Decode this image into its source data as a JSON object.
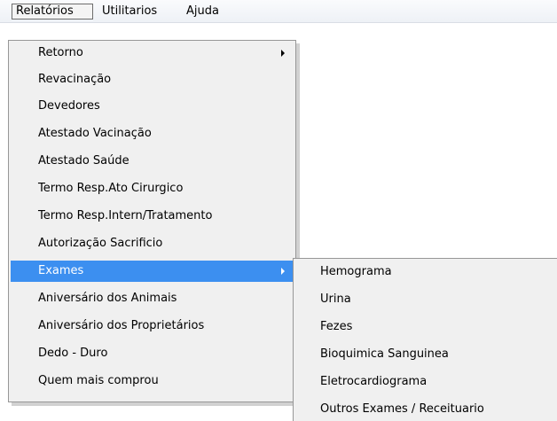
{
  "menubar": {
    "items": [
      {
        "label": "Relatórios"
      },
      {
        "label": "Utilitarios"
      },
      {
        "label": "Ajuda"
      }
    ]
  },
  "relatorios_menu": {
    "items": [
      {
        "label": "Retorno"
      },
      {
        "label": "Revacinação"
      },
      {
        "label": "Devedores"
      },
      {
        "label": "Atestado Vacinação"
      },
      {
        "label": "Atestado Saúde"
      },
      {
        "label": "Termo Resp.Ato Cirurgico"
      },
      {
        "label": "Termo Resp.Intern/Tratamento"
      },
      {
        "label": "Autorização Sacrificio"
      },
      {
        "label": "Exames"
      },
      {
        "label": "Aniversário dos Animais"
      },
      {
        "label": "Aniversário dos Proprietários"
      },
      {
        "label": "Dedo - Duro"
      },
      {
        "label": "Quem mais comprou"
      }
    ]
  },
  "exames_submenu": {
    "items": [
      {
        "label": "Hemograma"
      },
      {
        "label": "Urina"
      },
      {
        "label": "Fezes"
      },
      {
        "label": "Bioquimica Sanguinea"
      },
      {
        "label": "Eletrocardiograma"
      },
      {
        "label": "Outros Exames / Receituario"
      }
    ]
  },
  "colors": {
    "highlight": "#3c8ff0",
    "menu_background": "#f0f0f0",
    "menu_border": "#979797"
  },
  "icons": [
    "submenu-arrow-icon"
  ]
}
